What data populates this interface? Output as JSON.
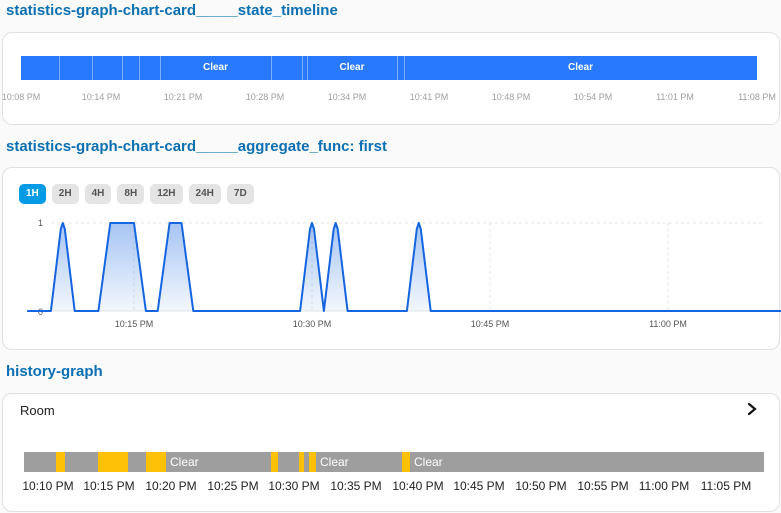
{
  "sections": {
    "timeline_title": "statistics-graph-chart-card_____state_timeline",
    "stats_title": "statistics-graph-chart-card_____aggregate_func: first",
    "history_title": "history-graph"
  },
  "timeline": {
    "state_labels": [
      "Clear",
      "Clear",
      "Clear"
    ],
    "ticks": [
      "10:08 PM",
      "10:14 PM",
      "10:21 PM",
      "10:28 PM",
      "10:34 PM",
      "10:41 PM",
      "10:48 PM",
      "10:54 PM",
      "11:01 PM",
      "11:08 PM"
    ],
    "bar_color": "#2979ff"
  },
  "stats": {
    "periods": [
      "1H",
      "2H",
      "4H",
      "8H",
      "12H",
      "24H",
      "7D"
    ],
    "active_period": "1H",
    "y_ticks": [
      "1",
      "0"
    ],
    "x_ticks": [
      "10:15 PM",
      "10:30 PM",
      "10:45 PM",
      "11:00 PM"
    ],
    "line_color": "#1565e0"
  },
  "chart_data": {
    "type": "line",
    "ylim": [
      0,
      1
    ],
    "x": [
      "10:06 PM",
      "10:08 PM",
      "10:09 PM",
      "10:10 PM",
      "10:11 PM",
      "10:12 PM",
      "10:13 PM",
      "10:14 PM",
      "10:15 PM",
      "10:16 PM",
      "10:17 PM",
      "10:18 PM",
      "10:19 PM",
      "10:20 PM",
      "10:21 PM",
      "10:29 PM",
      "10:30 PM",
      "10:31 PM",
      "10:32 PM",
      "10:33 PM",
      "10:38 PM",
      "10:39 PM",
      "10:40 PM",
      "11:10 PM"
    ],
    "series": [
      {
        "values": [
          0,
          0,
          1,
          0,
          0,
          0,
          1,
          1,
          1,
          0,
          0,
          1,
          1,
          0,
          0,
          0,
          1,
          0,
          1,
          0,
          0,
          1,
          0,
          0
        ]
      }
    ]
  },
  "history": {
    "entity_name": "Room",
    "state_labels": [
      "Clear",
      "Clear",
      "Clear"
    ],
    "ticks": [
      "10:10 PM",
      "10:15 PM",
      "10:20 PM",
      "10:25 PM",
      "10:30 PM",
      "10:35 PM",
      "10:40 PM",
      "10:45 PM",
      "10:50 PM",
      "10:55 PM",
      "11:00 PM",
      "11:05 PM"
    ],
    "colors": {
      "active": "#ffc107",
      "clear": "#9e9e9e"
    }
  }
}
